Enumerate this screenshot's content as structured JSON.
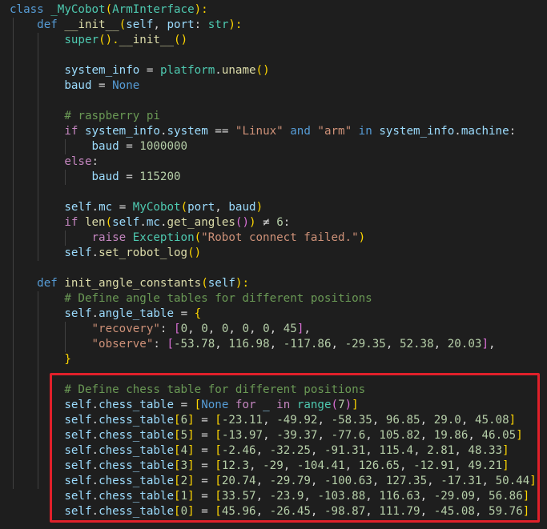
{
  "colors": {
    "background": "#1e1e1e",
    "default": "#d4d4d4",
    "keyword": "#569cd6",
    "control": "#c586c0",
    "function": "#dcdcaa",
    "class_name": "#4ec9b0",
    "variable": "#9cdcfe",
    "string": "#ce9178",
    "number": "#b5cea8",
    "comment": "#6a9955",
    "bracket_gold": "#ffd700",
    "bracket_pink": "#da70d6",
    "bracket_blue": "#179fff",
    "highlight_box": "#e0202a"
  },
  "code_lines": [
    [
      [
        "class ",
        "keyword"
      ],
      [
        "_MyCobot",
        "class_name"
      ],
      [
        "(",
        "bracket_gold"
      ],
      [
        "ArmInterface",
        "class_name"
      ],
      [
        "):",
        "bracket_gold"
      ]
    ],
    [
      [
        "    ",
        "default"
      ],
      [
        "def ",
        "keyword"
      ],
      [
        "__init__",
        "function"
      ],
      [
        "(",
        "bracket_gold"
      ],
      [
        "self",
        "variable"
      ],
      [
        ", ",
        "default"
      ],
      [
        "port",
        "variable"
      ],
      [
        ": ",
        "default"
      ],
      [
        "str",
        "class_name"
      ],
      [
        "):",
        "bracket_gold"
      ]
    ],
    [
      [
        "        ",
        "default"
      ],
      [
        "super",
        "class_name"
      ],
      [
        "().",
        "bracket_gold"
      ],
      [
        "__init__",
        "function"
      ],
      [
        "()",
        "bracket_gold"
      ]
    ],
    [],
    [
      [
        "        ",
        "default"
      ],
      [
        "system_info",
        "variable"
      ],
      [
        " = ",
        "default"
      ],
      [
        "platform",
        "class_name"
      ],
      [
        ".",
        "default"
      ],
      [
        "uname",
        "function"
      ],
      [
        "()",
        "bracket_gold"
      ]
    ],
    [
      [
        "        ",
        "default"
      ],
      [
        "baud",
        "variable"
      ],
      [
        " = ",
        "default"
      ],
      [
        "None",
        "keyword"
      ]
    ],
    [],
    [
      [
        "        ",
        "default"
      ],
      [
        "# raspberry pi",
        "comment"
      ]
    ],
    [
      [
        "        ",
        "default"
      ],
      [
        "if ",
        "control"
      ],
      [
        "system_info",
        "variable"
      ],
      [
        ".",
        "default"
      ],
      [
        "system",
        "variable"
      ],
      [
        " == ",
        "default"
      ],
      [
        "\"Linux\"",
        "string"
      ],
      [
        " and ",
        "keyword"
      ],
      [
        "\"arm\"",
        "string"
      ],
      [
        " in ",
        "keyword"
      ],
      [
        "system_info",
        "variable"
      ],
      [
        ".",
        "default"
      ],
      [
        "machine",
        "variable"
      ],
      [
        ":",
        "default"
      ]
    ],
    [
      [
        "            ",
        "default"
      ],
      [
        "baud",
        "variable"
      ],
      [
        " = ",
        "default"
      ],
      [
        "1000000",
        "number"
      ]
    ],
    [
      [
        "        ",
        "default"
      ],
      [
        "else",
        "control"
      ],
      [
        ":",
        "default"
      ]
    ],
    [
      [
        "            ",
        "default"
      ],
      [
        "baud",
        "variable"
      ],
      [
        " = ",
        "default"
      ],
      [
        "115200",
        "number"
      ]
    ],
    [],
    [
      [
        "        ",
        "default"
      ],
      [
        "self",
        "variable"
      ],
      [
        ".",
        "default"
      ],
      [
        "mc",
        "variable"
      ],
      [
        " = ",
        "default"
      ],
      [
        "MyCobot",
        "class_name"
      ],
      [
        "(",
        "bracket_gold"
      ],
      [
        "port",
        "variable"
      ],
      [
        ", ",
        "default"
      ],
      [
        "baud",
        "variable"
      ],
      [
        ")",
        "bracket_gold"
      ]
    ],
    [
      [
        "        ",
        "default"
      ],
      [
        "if ",
        "control"
      ],
      [
        "len",
        "function"
      ],
      [
        "(",
        "bracket_gold"
      ],
      [
        "self",
        "variable"
      ],
      [
        ".",
        "default"
      ],
      [
        "mc",
        "variable"
      ],
      [
        ".",
        "default"
      ],
      [
        "get_angles",
        "function"
      ],
      [
        "()",
        "bracket_pink"
      ],
      [
        ")",
        "bracket_gold"
      ],
      [
        " ≠ ",
        "default"
      ],
      [
        "6",
        "number"
      ],
      [
        ":",
        "default"
      ]
    ],
    [
      [
        "            ",
        "default"
      ],
      [
        "raise ",
        "control"
      ],
      [
        "Exception",
        "class_name"
      ],
      [
        "(",
        "bracket_gold"
      ],
      [
        "\"Robot connect failed.\"",
        "string"
      ],
      [
        ")",
        "bracket_gold"
      ]
    ],
    [
      [
        "        ",
        "default"
      ],
      [
        "self",
        "variable"
      ],
      [
        ".",
        "default"
      ],
      [
        "set_robot_log",
        "function"
      ],
      [
        "()",
        "bracket_gold"
      ]
    ],
    [],
    [
      [
        "    ",
        "default"
      ],
      [
        "def ",
        "keyword"
      ],
      [
        "init_angle_constants",
        "function"
      ],
      [
        "(",
        "bracket_gold"
      ],
      [
        "self",
        "variable"
      ],
      [
        "):",
        "bracket_gold"
      ]
    ],
    [
      [
        "        ",
        "default"
      ],
      [
        "# Define angle tables for different positions",
        "comment"
      ]
    ],
    [
      [
        "        ",
        "default"
      ],
      [
        "self",
        "variable"
      ],
      [
        ".",
        "default"
      ],
      [
        "angle_table",
        "variable"
      ],
      [
        " = ",
        "default"
      ],
      [
        "{",
        "bracket_gold"
      ]
    ],
    [
      [
        "            ",
        "default"
      ],
      [
        "\"recovery\"",
        "string"
      ],
      [
        ": ",
        "default"
      ],
      [
        "[",
        "bracket_pink"
      ],
      [
        "0",
        "number"
      ],
      [
        ", ",
        "default"
      ],
      [
        "0",
        "number"
      ],
      [
        ", ",
        "default"
      ],
      [
        "0",
        "number"
      ],
      [
        ", ",
        "default"
      ],
      [
        "0",
        "number"
      ],
      [
        ", ",
        "default"
      ],
      [
        "0",
        "number"
      ],
      [
        ", ",
        "default"
      ],
      [
        "45",
        "number"
      ],
      [
        "]",
        "bracket_pink"
      ],
      [
        ",",
        "default"
      ]
    ],
    [
      [
        "            ",
        "default"
      ],
      [
        "\"observe\"",
        "string"
      ],
      [
        ": ",
        "default"
      ],
      [
        "[",
        "bracket_pink"
      ],
      [
        "-53.78",
        "number"
      ],
      [
        ", ",
        "default"
      ],
      [
        "116.98",
        "number"
      ],
      [
        ", ",
        "default"
      ],
      [
        "-117.86",
        "number"
      ],
      [
        ", ",
        "default"
      ],
      [
        "-29.35",
        "number"
      ],
      [
        ", ",
        "default"
      ],
      [
        "52.38",
        "number"
      ],
      [
        ", ",
        "default"
      ],
      [
        "20.03",
        "number"
      ],
      [
        "]",
        "bracket_pink"
      ],
      [
        ",",
        "default"
      ]
    ],
    [
      [
        "        ",
        "default"
      ],
      [
        "}",
        "bracket_gold"
      ]
    ],
    [],
    [
      [
        "        ",
        "default"
      ],
      [
        "# Define chess table for different positions",
        "comment"
      ]
    ],
    [
      [
        "        ",
        "default"
      ],
      [
        "self",
        "variable"
      ],
      [
        ".",
        "default"
      ],
      [
        "chess_table",
        "variable"
      ],
      [
        " = ",
        "default"
      ],
      [
        "[",
        "bracket_gold"
      ],
      [
        "None",
        "keyword"
      ],
      [
        " for ",
        "control"
      ],
      [
        "_",
        "variable"
      ],
      [
        " in ",
        "control"
      ],
      [
        "range",
        "class_name"
      ],
      [
        "(",
        "bracket_pink"
      ],
      [
        "7",
        "number"
      ],
      [
        ")",
        "bracket_pink"
      ],
      [
        "]",
        "bracket_gold"
      ]
    ],
    [
      [
        "        ",
        "default"
      ],
      [
        "self",
        "variable"
      ],
      [
        ".",
        "default"
      ],
      [
        "chess_table",
        "variable"
      ],
      [
        "[",
        "bracket_gold"
      ],
      [
        "6",
        "number"
      ],
      [
        "]",
        "bracket_gold"
      ],
      [
        " = ",
        "default"
      ],
      [
        "[",
        "bracket_gold"
      ],
      [
        "-23.11",
        "number"
      ],
      [
        ", ",
        "default"
      ],
      [
        "-49.92",
        "number"
      ],
      [
        ", ",
        "default"
      ],
      [
        "-58.35",
        "number"
      ],
      [
        ", ",
        "default"
      ],
      [
        "96.85",
        "number"
      ],
      [
        ", ",
        "default"
      ],
      [
        "29.0",
        "number"
      ],
      [
        ", ",
        "default"
      ],
      [
        "45.08",
        "number"
      ],
      [
        "]",
        "bracket_gold"
      ]
    ],
    [
      [
        "        ",
        "default"
      ],
      [
        "self",
        "variable"
      ],
      [
        ".",
        "default"
      ],
      [
        "chess_table",
        "variable"
      ],
      [
        "[",
        "bracket_gold"
      ],
      [
        "5",
        "number"
      ],
      [
        "]",
        "bracket_gold"
      ],
      [
        " = ",
        "default"
      ],
      [
        "[",
        "bracket_gold"
      ],
      [
        "-13.97",
        "number"
      ],
      [
        ", ",
        "default"
      ],
      [
        "-39.37",
        "number"
      ],
      [
        ", ",
        "default"
      ],
      [
        "-77.6",
        "number"
      ],
      [
        ", ",
        "default"
      ],
      [
        "105.82",
        "number"
      ],
      [
        ", ",
        "default"
      ],
      [
        "19.86",
        "number"
      ],
      [
        ", ",
        "default"
      ],
      [
        "46.05",
        "number"
      ],
      [
        "]",
        "bracket_gold"
      ]
    ],
    [
      [
        "        ",
        "default"
      ],
      [
        "self",
        "variable"
      ],
      [
        ".",
        "default"
      ],
      [
        "chess_table",
        "variable"
      ],
      [
        "[",
        "bracket_gold"
      ],
      [
        "4",
        "number"
      ],
      [
        "]",
        "bracket_gold"
      ],
      [
        " = ",
        "default"
      ],
      [
        "[",
        "bracket_gold"
      ],
      [
        "-2.46",
        "number"
      ],
      [
        ", ",
        "default"
      ],
      [
        "-32.25",
        "number"
      ],
      [
        ", ",
        "default"
      ],
      [
        "-91.31",
        "number"
      ],
      [
        ", ",
        "default"
      ],
      [
        "115.4",
        "number"
      ],
      [
        ", ",
        "default"
      ],
      [
        "2.81",
        "number"
      ],
      [
        ", ",
        "default"
      ],
      [
        "48.33",
        "number"
      ],
      [
        "]",
        "bracket_gold"
      ]
    ],
    [
      [
        "        ",
        "default"
      ],
      [
        "self",
        "variable"
      ],
      [
        ".",
        "default"
      ],
      [
        "chess_table",
        "variable"
      ],
      [
        "[",
        "bracket_gold"
      ],
      [
        "3",
        "number"
      ],
      [
        "]",
        "bracket_gold"
      ],
      [
        " = ",
        "default"
      ],
      [
        "[",
        "bracket_gold"
      ],
      [
        "12.3",
        "number"
      ],
      [
        ", ",
        "default"
      ],
      [
        "-29",
        "number"
      ],
      [
        ", ",
        "default"
      ],
      [
        "-104.41",
        "number"
      ],
      [
        ", ",
        "default"
      ],
      [
        "126.65",
        "number"
      ],
      [
        ", ",
        "default"
      ],
      [
        "-12.91",
        "number"
      ],
      [
        ", ",
        "default"
      ],
      [
        "49.21",
        "number"
      ],
      [
        "]",
        "bracket_gold"
      ]
    ],
    [
      [
        "        ",
        "default"
      ],
      [
        "self",
        "variable"
      ],
      [
        ".",
        "default"
      ],
      [
        "chess_table",
        "variable"
      ],
      [
        "[",
        "bracket_gold"
      ],
      [
        "2",
        "number"
      ],
      [
        "]",
        "bracket_gold"
      ],
      [
        " = ",
        "default"
      ],
      [
        "[",
        "bracket_gold"
      ],
      [
        "20.74",
        "number"
      ],
      [
        ", ",
        "default"
      ],
      [
        "-29.79",
        "number"
      ],
      [
        ", ",
        "default"
      ],
      [
        "-100.63",
        "number"
      ],
      [
        ", ",
        "default"
      ],
      [
        "127.35",
        "number"
      ],
      [
        ", ",
        "default"
      ],
      [
        "-17.31",
        "number"
      ],
      [
        ", ",
        "default"
      ],
      [
        "50.44",
        "number"
      ],
      [
        "]",
        "bracket_gold"
      ]
    ],
    [
      [
        "        ",
        "default"
      ],
      [
        "self",
        "variable"
      ],
      [
        ".",
        "default"
      ],
      [
        "chess_table",
        "variable"
      ],
      [
        "[",
        "bracket_gold"
      ],
      [
        "1",
        "number"
      ],
      [
        "]",
        "bracket_gold"
      ],
      [
        " = ",
        "default"
      ],
      [
        "[",
        "bracket_gold"
      ],
      [
        "33.57",
        "number"
      ],
      [
        ", ",
        "default"
      ],
      [
        "-23.9",
        "number"
      ],
      [
        ", ",
        "default"
      ],
      [
        "-103.88",
        "number"
      ],
      [
        ", ",
        "default"
      ],
      [
        "116.63",
        "number"
      ],
      [
        ", ",
        "default"
      ],
      [
        "-29.09",
        "number"
      ],
      [
        ", ",
        "default"
      ],
      [
        "56.86",
        "number"
      ],
      [
        "]",
        "bracket_gold"
      ]
    ],
    [
      [
        "        ",
        "default"
      ],
      [
        "self",
        "variable"
      ],
      [
        ".",
        "default"
      ],
      [
        "chess_table",
        "variable"
      ],
      [
        "[",
        "bracket_gold"
      ],
      [
        "0",
        "number"
      ],
      [
        "]",
        "bracket_gold"
      ],
      [
        " = ",
        "default"
      ],
      [
        "[",
        "bracket_gold"
      ],
      [
        "45.96",
        "number"
      ],
      [
        ", ",
        "default"
      ],
      [
        "-26.45",
        "number"
      ],
      [
        ", ",
        "default"
      ],
      [
        "-98.87",
        "number"
      ],
      [
        ", ",
        "default"
      ],
      [
        "111.79",
        "number"
      ],
      [
        ", ",
        "default"
      ],
      [
        "-45.08",
        "number"
      ],
      [
        ", ",
        "default"
      ],
      [
        "59.76",
        "number"
      ],
      [
        "]",
        "bracket_gold"
      ]
    ]
  ]
}
